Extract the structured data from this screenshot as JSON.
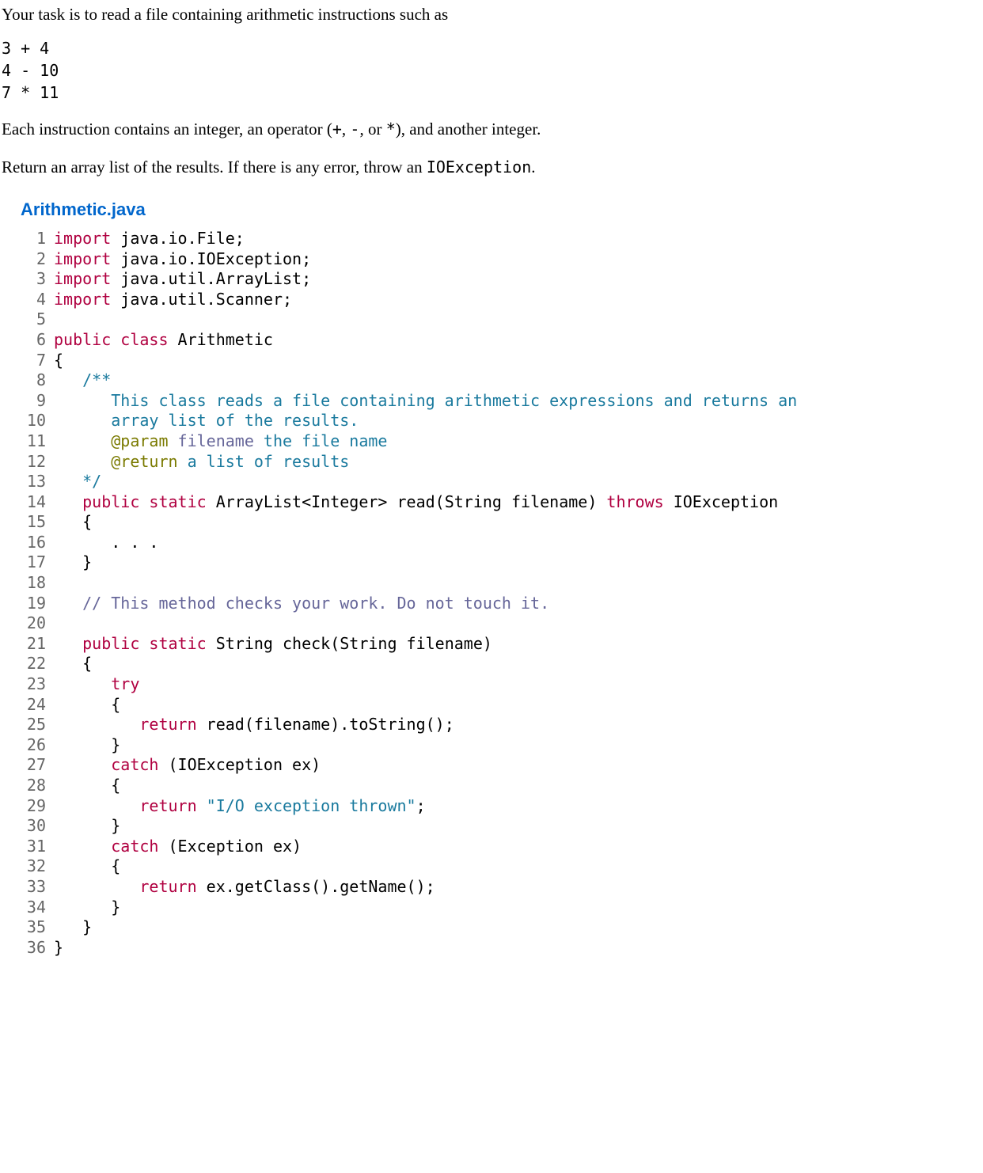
{
  "intro": {
    "p1": "Your task is to read a file containing arithmetic instructions such as",
    "example": "3 + 4\n4 - 10\n7 * 11",
    "p2_pre": "Each instruction contains an integer, an operator (",
    "p2_ops": "+",
    "p2_mid1": ", ",
    "p2_ops2": "-",
    "p2_mid2": ", or ",
    "p2_ops3": "*",
    "p2_post": "), and another integer.",
    "p3_pre": "Return an array list of the results. If there is any error, throw an ",
    "p3_code": "IOException",
    "p3_post": "."
  },
  "filename": "Arithmetic.java",
  "code": {
    "line_count": 36,
    "lines": [
      {
        "n": 1,
        "tokens": [
          {
            "t": "import",
            "c": "kw"
          },
          {
            "t": " java.io.File;"
          }
        ]
      },
      {
        "n": 2,
        "tokens": [
          {
            "t": "import",
            "c": "kw"
          },
          {
            "t": " java.io.IOException;"
          }
        ]
      },
      {
        "n": 3,
        "tokens": [
          {
            "t": "import",
            "c": "kw"
          },
          {
            "t": " java.util.ArrayList;"
          }
        ]
      },
      {
        "n": 4,
        "tokens": [
          {
            "t": "import",
            "c": "kw"
          },
          {
            "t": " java.util.Scanner;"
          }
        ]
      },
      {
        "n": 5,
        "tokens": []
      },
      {
        "n": 6,
        "tokens": [
          {
            "t": "public",
            "c": "kw"
          },
          {
            "t": " "
          },
          {
            "t": "class",
            "c": "kw"
          },
          {
            "t": " Arithmetic"
          }
        ]
      },
      {
        "n": 7,
        "tokens": [
          {
            "t": "{"
          }
        ]
      },
      {
        "n": 8,
        "tokens": [
          {
            "t": "   "
          },
          {
            "t": "/**",
            "c": "doccmt"
          }
        ]
      },
      {
        "n": 9,
        "tokens": [
          {
            "t": "      "
          },
          {
            "t": "This class reads a file containing arithmetic expressions and returns an",
            "c": "doccmt"
          }
        ]
      },
      {
        "n": 10,
        "tokens": [
          {
            "t": "      "
          },
          {
            "t": "array list of the results.",
            "c": "doccmt"
          }
        ]
      },
      {
        "n": 11,
        "tokens": [
          {
            "t": "      "
          },
          {
            "t": "@param",
            "c": "doctag"
          },
          {
            "t": " "
          },
          {
            "t": "filename",
            "c": "doctag-id"
          },
          {
            "t": " "
          },
          {
            "t": "the file name",
            "c": "doccmt"
          }
        ]
      },
      {
        "n": 12,
        "tokens": [
          {
            "t": "      "
          },
          {
            "t": "@return",
            "c": "doctag"
          },
          {
            "t": " "
          },
          {
            "t": "a list of results",
            "c": "doccmt"
          }
        ]
      },
      {
        "n": 13,
        "tokens": [
          {
            "t": "   "
          },
          {
            "t": "*/",
            "c": "doccmt"
          }
        ]
      },
      {
        "n": 14,
        "tokens": [
          {
            "t": "   "
          },
          {
            "t": "public",
            "c": "kw"
          },
          {
            "t": " "
          },
          {
            "t": "static",
            "c": "kw"
          },
          {
            "t": " ArrayList<Integer> read(String filename) "
          },
          {
            "t": "throws",
            "c": "kw"
          },
          {
            "t": " IOException"
          }
        ]
      },
      {
        "n": 15,
        "tokens": [
          {
            "t": "   {"
          }
        ]
      },
      {
        "n": 16,
        "tokens": [
          {
            "t": "      . . ."
          }
        ]
      },
      {
        "n": 17,
        "tokens": [
          {
            "t": "   }"
          }
        ]
      },
      {
        "n": 18,
        "tokens": []
      },
      {
        "n": 19,
        "tokens": [
          {
            "t": "   "
          },
          {
            "t": "// This method checks your work. Do not touch it.",
            "c": "cmt"
          }
        ]
      },
      {
        "n": 20,
        "tokens": []
      },
      {
        "n": 21,
        "tokens": [
          {
            "t": "   "
          },
          {
            "t": "public",
            "c": "kw"
          },
          {
            "t": " "
          },
          {
            "t": "static",
            "c": "kw"
          },
          {
            "t": " String check(String filename)"
          }
        ]
      },
      {
        "n": 22,
        "tokens": [
          {
            "t": "   {"
          }
        ]
      },
      {
        "n": 23,
        "tokens": [
          {
            "t": "      "
          },
          {
            "t": "try",
            "c": "kw"
          }
        ]
      },
      {
        "n": 24,
        "tokens": [
          {
            "t": "      {"
          }
        ]
      },
      {
        "n": 25,
        "tokens": [
          {
            "t": "         "
          },
          {
            "t": "return",
            "c": "kw"
          },
          {
            "t": " read(filename).toString();"
          }
        ]
      },
      {
        "n": 26,
        "tokens": [
          {
            "t": "      }"
          }
        ]
      },
      {
        "n": 27,
        "tokens": [
          {
            "t": "      "
          },
          {
            "t": "catch",
            "c": "kw"
          },
          {
            "t": " (IOException ex)"
          }
        ]
      },
      {
        "n": 28,
        "tokens": [
          {
            "t": "      {"
          }
        ]
      },
      {
        "n": 29,
        "tokens": [
          {
            "t": "         "
          },
          {
            "t": "return",
            "c": "kw"
          },
          {
            "t": " "
          },
          {
            "t": "\"I/O exception thrown\"",
            "c": "str"
          },
          {
            "t": ";"
          }
        ]
      },
      {
        "n": 30,
        "tokens": [
          {
            "t": "      }"
          }
        ]
      },
      {
        "n": 31,
        "tokens": [
          {
            "t": "      "
          },
          {
            "t": "catch",
            "c": "kw"
          },
          {
            "t": " (Exception ex)"
          }
        ]
      },
      {
        "n": 32,
        "tokens": [
          {
            "t": "      {"
          }
        ]
      },
      {
        "n": 33,
        "tokens": [
          {
            "t": "         "
          },
          {
            "t": "return",
            "c": "kw"
          },
          {
            "t": " ex.getClass().getName();"
          }
        ]
      },
      {
        "n": 34,
        "tokens": [
          {
            "t": "      }"
          }
        ]
      },
      {
        "n": 35,
        "tokens": [
          {
            "t": "   }"
          }
        ]
      },
      {
        "n": 36,
        "tokens": [
          {
            "t": "}"
          }
        ]
      }
    ]
  }
}
